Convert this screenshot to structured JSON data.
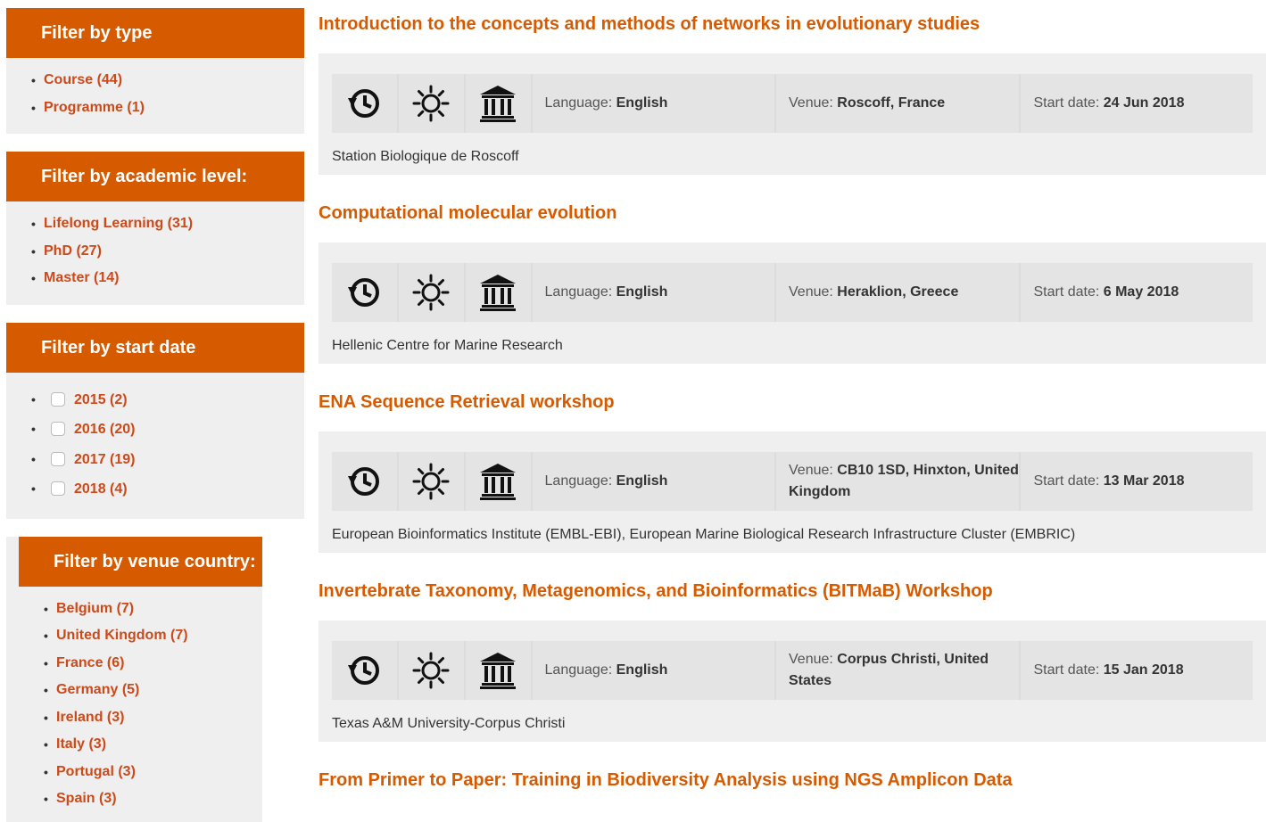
{
  "filters": {
    "type": {
      "heading": "Filter by type",
      "items": [
        "Course (44)",
        "Programme (1)"
      ]
    },
    "academic": {
      "heading": "Filter by academic level:",
      "items": [
        "Lifelong Learning (31)",
        "PhD (27)",
        "Master (14)"
      ]
    },
    "start_date": {
      "heading": "Filter by start date",
      "items": [
        "2015 (2)",
        "2016 (20)",
        "2017 (19)",
        "2018 (4)"
      ]
    },
    "venue_country": {
      "heading": "Filter by venue country:",
      "items": [
        "Belgium (7)",
        "United Kingdom (7)",
        "France (6)",
        "Germany (5)",
        "Ireland (3)",
        "Italy (3)",
        "Portugal (3)",
        "Spain (3)"
      ]
    }
  },
  "labels": {
    "language": "Language:",
    "venue": "Venue:",
    "start_date": "Start date:"
  },
  "icons": [
    "history-icon",
    "sun-icon",
    "institution-icon"
  ],
  "accent_color": "#d65a00",
  "events": [
    {
      "title": "Introduction to the concepts and methods of networks in evolutionary studies",
      "language": "English",
      "venue": "Roscoff, France",
      "start_date": "24 Jun 2018",
      "host": "Station Biologique de Roscoff"
    },
    {
      "title": "Computational molecular evolution",
      "language": "English",
      "venue": "Heraklion, Greece",
      "start_date": "6 May 2018",
      "host": "Hellenic Centre for Marine Research"
    },
    {
      "title": "ENA Sequence Retrieval workshop",
      "language": "English",
      "venue": "CB10 1SD, Hinxton, United Kingdom",
      "start_date": "13 Mar 2018",
      "host": "European Bioinformatics Institute (EMBL-EBI), European Marine Biological Research Infrastructure Cluster (EMBRIC)"
    },
    {
      "title": "Invertebrate Taxonomy, Metagenomics, and Bioinformatics (BITMaB) Workshop",
      "language": "English",
      "venue": "Corpus Christi, United States",
      "start_date": "15 Jan 2018",
      "host": "Texas A&M University-Corpus Christi"
    },
    {
      "title": "From Primer to Paper: Training in Biodiversity Analysis using NGS Amplicon Data"
    }
  ]
}
